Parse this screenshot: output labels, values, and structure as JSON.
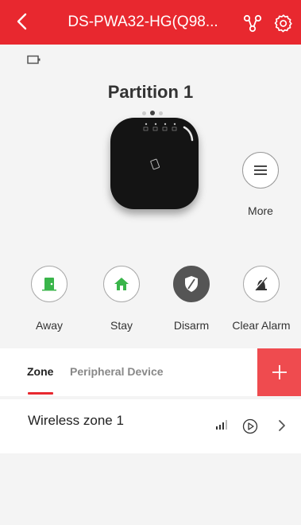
{
  "header": {
    "title": "DS-PWA32-HG(Q98..."
  },
  "partition": {
    "title": "Partition 1",
    "page_count": 3,
    "active_page": 2
  },
  "more": {
    "label": "More"
  },
  "actions": [
    {
      "label": "Away",
      "icon": "away-door-icon"
    },
    {
      "label": "Stay",
      "icon": "stay-home-icon"
    },
    {
      "label": "Disarm",
      "icon": "disarm-shield-icon",
      "selected": true
    },
    {
      "label": "Clear Alarm",
      "icon": "clear-alarm-icon"
    }
  ],
  "tabs": [
    {
      "label": "Zone",
      "active": true
    },
    {
      "label": "Peripheral Device",
      "active": false
    }
  ],
  "zones": [
    {
      "name": "Wireless zone 1"
    }
  ],
  "colors": {
    "brand_red": "#e8282f",
    "add_button": "#ef4b4f",
    "stay_green": "#39b54a",
    "away_green": "#39b54a"
  }
}
